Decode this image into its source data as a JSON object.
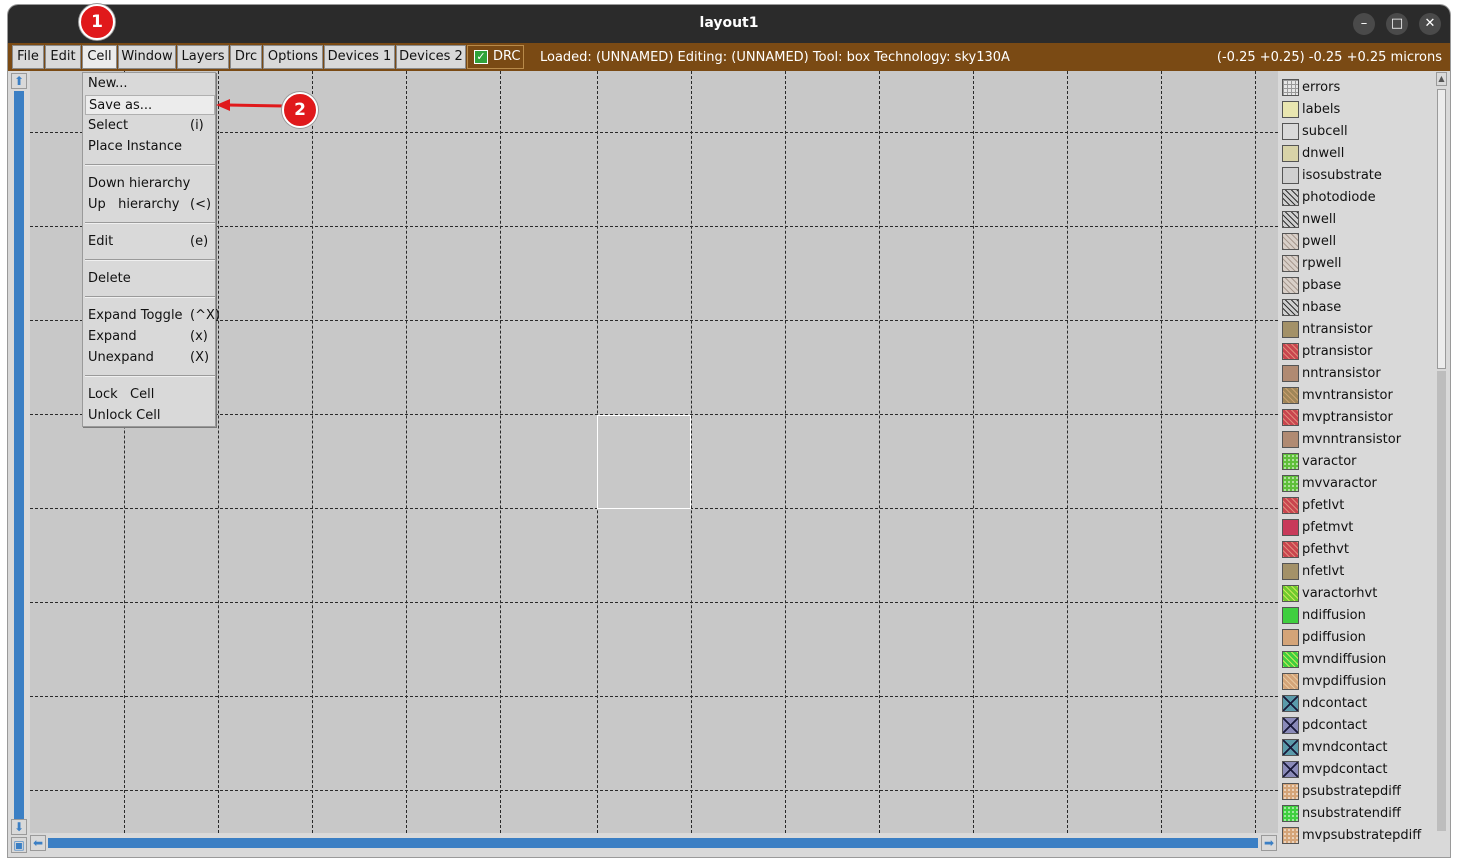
{
  "window": {
    "title": "layout1",
    "controls": [
      "–",
      "□",
      "✕"
    ]
  },
  "menubar": {
    "items": [
      {
        "label": "File"
      },
      {
        "label": "Edit"
      },
      {
        "label": "Cell"
      },
      {
        "label": "Window"
      },
      {
        "label": "Layers"
      },
      {
        "label": "Drc"
      },
      {
        "label": "Options"
      },
      {
        "label": "Devices 1"
      },
      {
        "label": "Devices 2"
      }
    ],
    "drc": {
      "label": "DRC",
      "checked": true
    },
    "status": "Loaded: (UNNAMED) Editing: (UNNAMED) Tool: box  Technology: sky130A",
    "coords": "(-0.25 +0.25) -0.25 +0.25 microns",
    "bg_color": "#7a4a14"
  },
  "cell_menu": {
    "items": [
      {
        "label": "New...",
        "shortcut": ""
      },
      {
        "label": "Save as...",
        "shortcut": ""
      },
      {
        "label": "Select",
        "shortcut": "(i)"
      },
      {
        "label": "Place Instance",
        "shortcut": ""
      },
      {
        "label": "Down hierarchy",
        "shortcut": ""
      },
      {
        "label": "Up   hierarchy",
        "shortcut": "(<)"
      },
      {
        "label": "Edit",
        "shortcut": "(e)"
      },
      {
        "label": "Delete",
        "shortcut": ""
      },
      {
        "label": "Expand Toggle",
        "shortcut": "(^X)"
      },
      {
        "label": "Expand",
        "shortcut": "(x)"
      },
      {
        "label": "Unexpand",
        "shortcut": "(X)"
      },
      {
        "label": "Lock   Cell",
        "shortcut": ""
      },
      {
        "label": "Unlock Cell",
        "shortcut": ""
      }
    ]
  },
  "annotations": {
    "step1": "1",
    "step2": "2",
    "color": "#e0191b"
  },
  "layers": [
    {
      "name": "errors",
      "color": "#e6e6e6",
      "pattern": "grid"
    },
    {
      "name": "labels",
      "color": "#e9e6b0",
      "pattern": "solid"
    },
    {
      "name": "subcell",
      "color": "#d9d9d9",
      "pattern": "solid"
    },
    {
      "name": "dnwell",
      "color": "#d8d3a8",
      "pattern": "solid"
    },
    {
      "name": "isosubstrate",
      "color": "#d0d0d0",
      "pattern": "solid"
    },
    {
      "name": "photodiode",
      "color": "#cfcfcf",
      "pattern": "hatch"
    },
    {
      "name": "nwell",
      "color": "#cfcfcf",
      "pattern": "hatch"
    },
    {
      "name": "pwell",
      "color": "#d8cfc8",
      "pattern": "hatch-light"
    },
    {
      "name": "rpwell",
      "color": "#d8cfc8",
      "pattern": "hatch-light"
    },
    {
      "name": "pbase",
      "color": "#d8cfc8",
      "pattern": "hatch-light"
    },
    {
      "name": "nbase",
      "color": "#cfcfcf",
      "pattern": "hatch"
    },
    {
      "name": "ntransistor",
      "color": "#a39168",
      "pattern": "solid"
    },
    {
      "name": "ptransistor",
      "color": "#c9454e",
      "pattern": "hatch-red"
    },
    {
      "name": "nntransistor",
      "color": "#b08a72",
      "pattern": "solid"
    },
    {
      "name": "mvntransistor",
      "color": "#a08658",
      "pattern": "hatch-brown"
    },
    {
      "name": "mvptransistor",
      "color": "#c9454e",
      "pattern": "hatch-red"
    },
    {
      "name": "mvnntransistor",
      "color": "#b08a72",
      "pattern": "solid"
    },
    {
      "name": "varactor",
      "color": "#5fbf3a",
      "pattern": "dots"
    },
    {
      "name": "mvvaractor",
      "color": "#5fbf3a",
      "pattern": "dots"
    },
    {
      "name": "pfetlvt",
      "color": "#c9454e",
      "pattern": "hatch-red"
    },
    {
      "name": "pfetmvt",
      "color": "#c83a5a",
      "pattern": "solid"
    },
    {
      "name": "pfethvt",
      "color": "#c9454e",
      "pattern": "hatch-red"
    },
    {
      "name": "nfetlvt",
      "color": "#a39168",
      "pattern": "solid"
    },
    {
      "name": "varactorhvt",
      "color": "#6fca2e",
      "pattern": "hatch-green"
    },
    {
      "name": "ndiffusion",
      "color": "#3fcf3f",
      "pattern": "solid"
    },
    {
      "name": "pdiffusion",
      "color": "#d4a478",
      "pattern": "solid"
    },
    {
      "name": "mvndiffusion",
      "color": "#3fcf3f",
      "pattern": "hatch-green"
    },
    {
      "name": "mvpdiffusion",
      "color": "#d4a478",
      "pattern": "hatch-tan"
    },
    {
      "name": "ndcontact",
      "color": "#5a9aaa",
      "pattern": "cross"
    },
    {
      "name": "pdcontact",
      "color": "#8a8ab8",
      "pattern": "cross"
    },
    {
      "name": "mvndcontact",
      "color": "#5a9aaa",
      "pattern": "cross"
    },
    {
      "name": "mvpdcontact",
      "color": "#8a8ab8",
      "pattern": "cross"
    },
    {
      "name": "psubstratepdiff",
      "color": "#d4a478",
      "pattern": "dots"
    },
    {
      "name": "nsubstratendiff",
      "color": "#3fcf3f",
      "pattern": "dots"
    },
    {
      "name": "mvpsubstratepdiff",
      "color": "#d4a478",
      "pattern": "dots"
    }
  ]
}
